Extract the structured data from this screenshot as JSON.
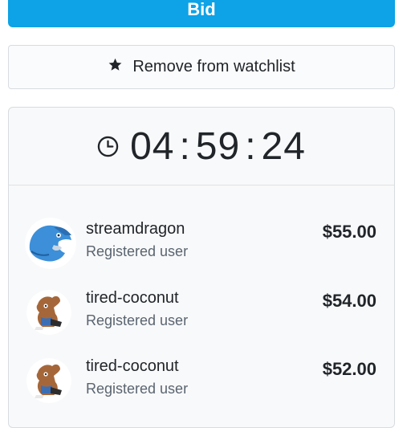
{
  "actions": {
    "bid_label": "Bid",
    "watchlist_label": "Remove from watchlist"
  },
  "timer": {
    "hours": "04",
    "minutes": "59",
    "seconds": "24",
    "separator": ":"
  },
  "bids": [
    {
      "user": "streamdragon",
      "role": "Registered user",
      "amount": "$55.00",
      "avatar_icon": "blue-dragon-avatar"
    },
    {
      "user": "tired-coconut",
      "role": "Registered user",
      "amount": "$54.00",
      "avatar_icon": "brown-creature-avatar"
    },
    {
      "user": "tired-coconut",
      "role": "Registered user",
      "amount": "$52.00",
      "avatar_icon": "brown-creature-avatar"
    }
  ],
  "colors": {
    "accent": "#0ea2e6",
    "text": "#212529",
    "muted": "#5a6470"
  }
}
